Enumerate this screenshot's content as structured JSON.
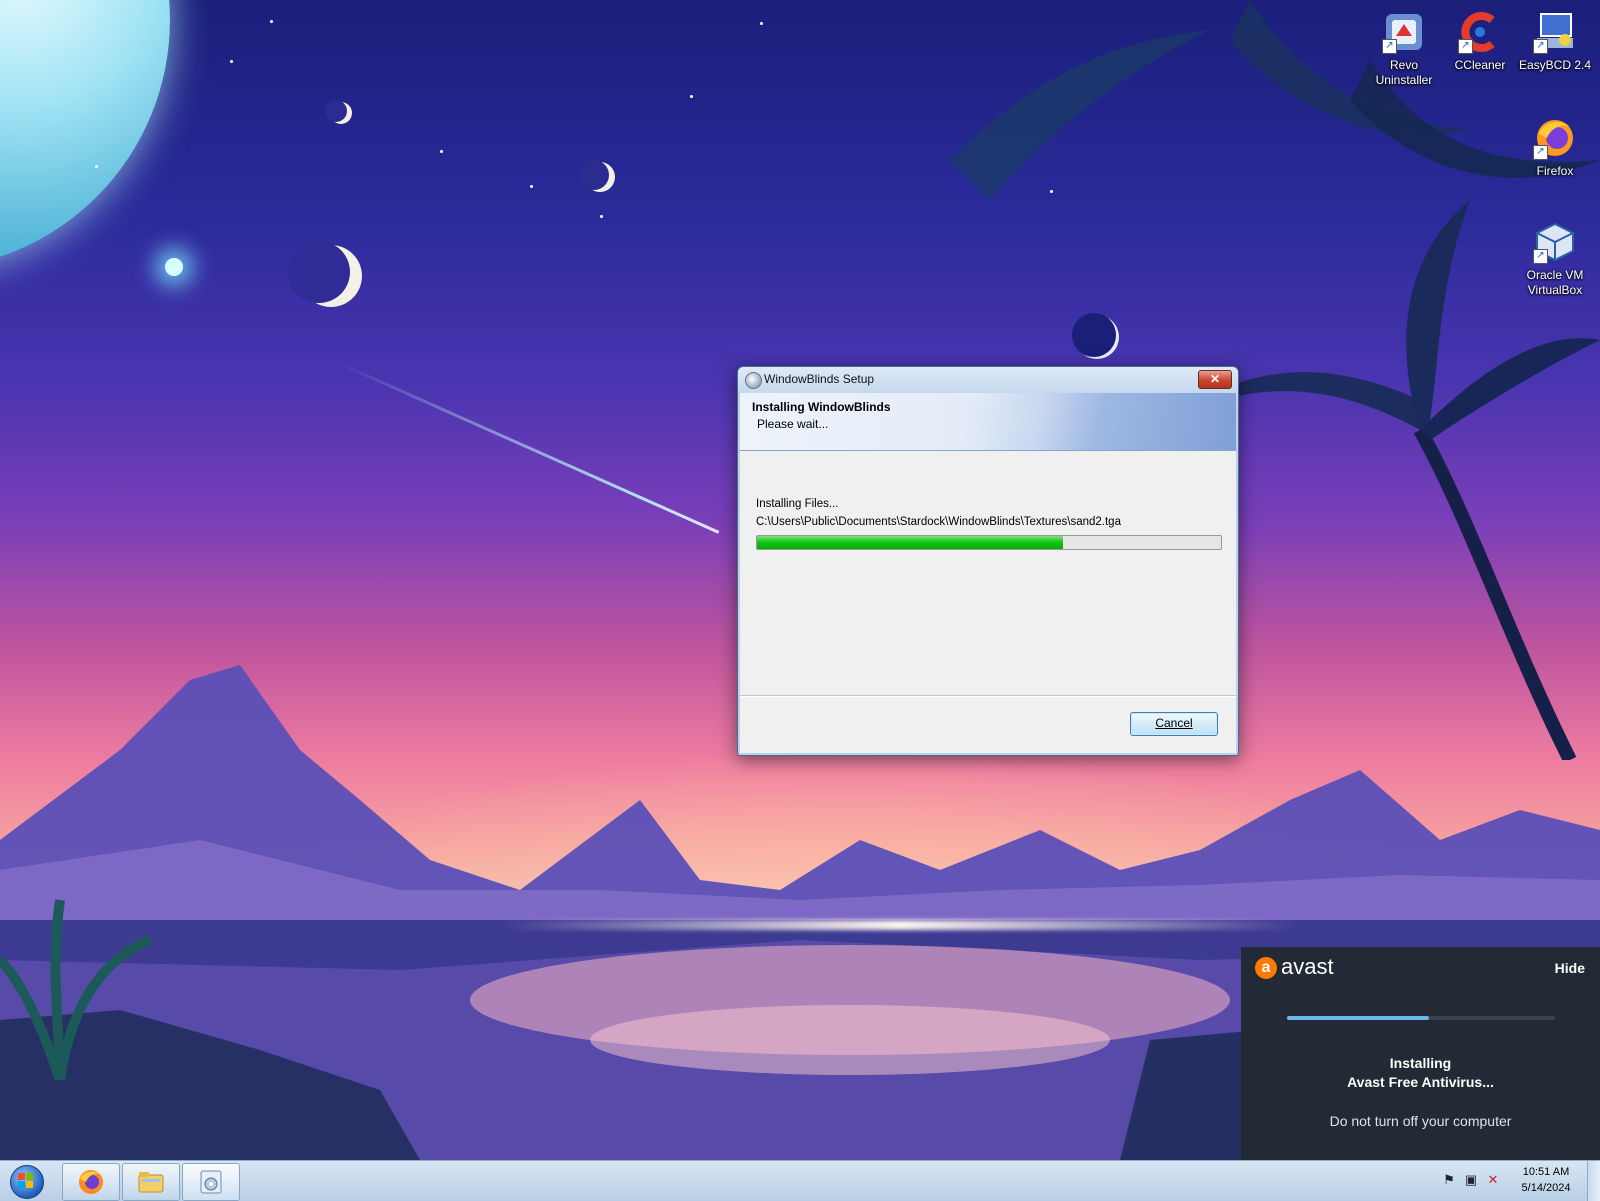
{
  "desktop": {
    "icons": [
      {
        "label": "Revo Uninstaller",
        "icon": "revo-uninstaller-icon"
      },
      {
        "label": "CCleaner",
        "icon": "ccleaner-icon"
      },
      {
        "label": "EasyBCD 2.4",
        "icon": "easybcd-icon"
      },
      {
        "label": "Firefox",
        "icon": "firefox-icon"
      },
      {
        "label": "Oracle VM VirtualBox",
        "icon": "virtualbox-icon"
      }
    ]
  },
  "dialog": {
    "title": "WindowBlinds Setup",
    "close_label": "✕",
    "heading": "Installing WindowBlinds",
    "subheading": "Please wait...",
    "status": "Installing Files...",
    "path": "C:\\Users\\Public\\Documents\\Stardock\\WindowBlinds\\Textures\\sand2.tga",
    "progress": 0.66,
    "progress_color": "#11c411",
    "cancel_label": "Cancel"
  },
  "avast": {
    "brand": "avast",
    "logo_letter": "a",
    "hide_label": "Hide",
    "progress": 0.53,
    "line1": "Installing",
    "line2": "Avast Free Antivirus...",
    "line3": "Do not turn off your computer",
    "accent": "#ff7800"
  },
  "taskbar": {
    "pinned": [
      {
        "name": "firefox",
        "icon": "firefox-icon"
      },
      {
        "name": "windows-explorer",
        "icon": "folder-icon"
      },
      {
        "name": "setup",
        "icon": "installer-icon"
      }
    ],
    "tray_icons": [
      "flag-icon",
      "network-icon",
      "volume-muted-icon"
    ],
    "time": "10:51 AM",
    "date": "5/14/2024"
  }
}
